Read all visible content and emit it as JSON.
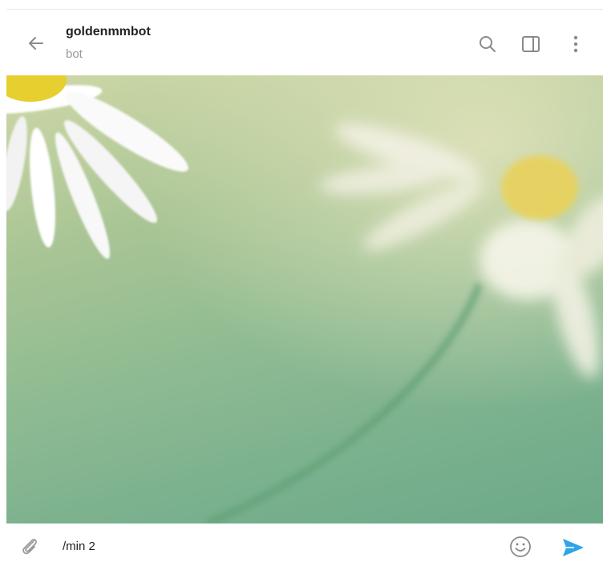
{
  "chat": {
    "title": "goldenmmbot",
    "status": "bot"
  },
  "header": {
    "back_icon": "arrow-left-icon",
    "actions": [
      {
        "name": "search-icon"
      },
      {
        "name": "sidebar-toggle-icon"
      },
      {
        "name": "more-vertical-icon"
      }
    ]
  },
  "wallpaper": {
    "description_icon": "chamomile-wallpaper"
  },
  "composer": {
    "attach_icon": "paperclip-icon",
    "input_value": "/min 2",
    "emoji_icon": "smile-icon",
    "send_icon": "send-arrow-icon"
  },
  "colors": {
    "accent": "#2fa4e7",
    "icon_gray": "#8a8a8a",
    "title_text": "#222222",
    "subtitle_text": "#999999"
  }
}
